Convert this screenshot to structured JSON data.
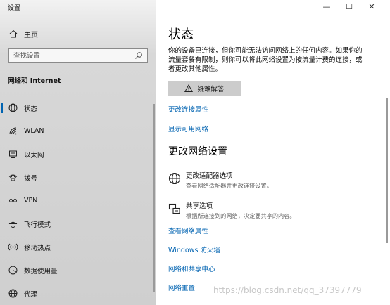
{
  "window": {
    "title": "设置",
    "controls": [
      "—",
      "☐",
      "✕"
    ]
  },
  "sidebar": {
    "home_label": "主页",
    "search_placeholder": "查找设置",
    "section_title": "网络和 Internet",
    "items": [
      {
        "label": "状态",
        "icon": "globe-icon",
        "active": true
      },
      {
        "label": "WLAN",
        "icon": "wifi-icon",
        "active": false
      },
      {
        "label": "以太网",
        "icon": "ethernet-icon",
        "active": false
      },
      {
        "label": "拨号",
        "icon": "dialup-icon",
        "active": false
      },
      {
        "label": "VPN",
        "icon": "vpn-icon",
        "active": false
      },
      {
        "label": "飞行模式",
        "icon": "airplane-icon",
        "active": false
      },
      {
        "label": "移动热点",
        "icon": "hotspot-icon",
        "active": false
      },
      {
        "label": "数据使用量",
        "icon": "data-usage-icon",
        "active": false
      },
      {
        "label": "代理",
        "icon": "proxy-globe-icon",
        "active": false
      }
    ]
  },
  "main": {
    "title": "状态",
    "description_line1": "你的设备已连接，但你可能无法访问网络上的任何内容。如果你的",
    "description_line2": "流量套餐有限制，则你可以将此网络设置为按流量计费的连接，或",
    "description_line3": "者更改其他属性。",
    "troubleshoot_label": "疑难解答",
    "link_change_connection": "更改连接属性",
    "link_show_networks": "显示可用网络",
    "section_heading": "更改网络设置",
    "option_adapter_title": "更改适配器选项",
    "option_adapter_subtitle": "查看网络适配器并更改连接设置。",
    "option_sharing_title": "共享选项",
    "option_sharing_subtitle": "根据所连接到的网络，决定要共享的内容。",
    "link_view_properties": "查看网络属性",
    "link_firewall": "Windows 防火墙",
    "link_sharing_center": "网络和共享中心",
    "link_reset": "网络重置"
  },
  "watermark": "https://blog.csdn.net/qq_37397779",
  "colors": {
    "accent": "#0063b1",
    "sidebar_bg": "#d3d3d3",
    "button_bg": "#cccccc"
  }
}
